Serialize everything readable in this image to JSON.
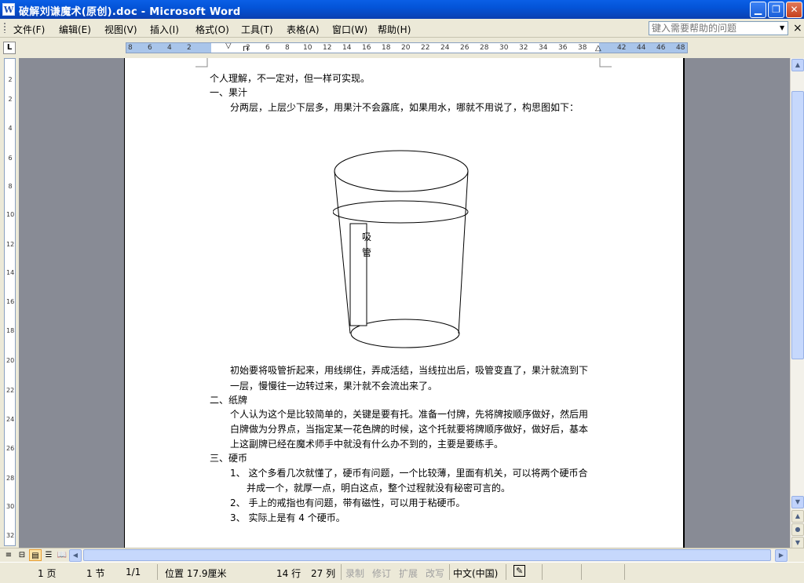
{
  "window": {
    "title": "破解刘谦魔术(原创).doc - Microsoft Word",
    "icon": "word-doc-icon",
    "minimize": "minimize-icon",
    "restore": "restore-icon",
    "close": "close-icon"
  },
  "menu": {
    "items": [
      {
        "label": "文件(F)"
      },
      {
        "label": "编辑(E)"
      },
      {
        "label": "视图(V)"
      },
      {
        "label": "插入(I)"
      },
      {
        "label": "格式(O)"
      },
      {
        "label": "工具(T)"
      },
      {
        "label": "表格(A)"
      },
      {
        "label": "窗口(W)"
      },
      {
        "label": "帮助(H)"
      }
    ],
    "help_placeholder": "键入需要帮助的问题"
  },
  "ruler": {
    "labels": [
      "8",
      "6",
      "4",
      "2",
      "2",
      "4",
      "6",
      "8",
      "10",
      "12",
      "14",
      "16",
      "18",
      "20",
      "22",
      "24",
      "26",
      "28",
      "30",
      "32",
      "34",
      "36",
      "38",
      "42",
      "44",
      "46",
      "48"
    ],
    "vlabels": [
      "2",
      "2",
      "4",
      "6",
      "8",
      "10",
      "12",
      "14",
      "16",
      "18",
      "20",
      "22",
      "24",
      "26",
      "28",
      "30",
      "32"
    ]
  },
  "document": {
    "lines": [
      "个人理解，不一定对，但一样可实现。",
      "一、果汁",
      "分两层，上层少下层多，用果汁不会露底，如果用水，哪就不用说了，构思图如下：",
      "初始要将吸管折起来，用线绑住，弄成活结，当线拉出后，吸管变直了，果汁就流到下",
      "一层，慢慢往一边转过来，果汁就不会流出来了。",
      "二、纸牌",
      "个人认为这个是比较简单的，关键是要有托。准备一付牌，先将牌按顺序做好，然后用",
      "白牌做为分界点，当指定某一花色牌的时候，这个托就要将牌顺序做好，做好后，基本",
      "上这副牌已经在魔术师手中就没有什么办不到的，主要是要练手。",
      "三、硬币",
      "1、 这个多看几次就懂了，硬币有问题，一个比较薄，里面有机关，可以将两个硬币合",
      "并成一个，就厚一点，明白这点，整个过程就没有秘密可言的。",
      "2、 手上的戒指也有问题，带有磁性，可以用于粘硬币。",
      "3、 实际上是有 4 个硬币。"
    ],
    "straw_label_1": "吸",
    "straw_label_2": "管"
  },
  "status": {
    "page": "1 页",
    "section": "1 节",
    "page_of": "1/1",
    "position": "位置 17.9厘米",
    "line": "14 行",
    "column": "27 列",
    "rec": "录制",
    "trk": "修订",
    "ext": "扩展",
    "ovr": "改写",
    "language": "中文(中国)"
  },
  "colors": {
    "titlebar": "#0454d8",
    "chrome": "#ece9d8",
    "doc_background": "#888b95"
  }
}
